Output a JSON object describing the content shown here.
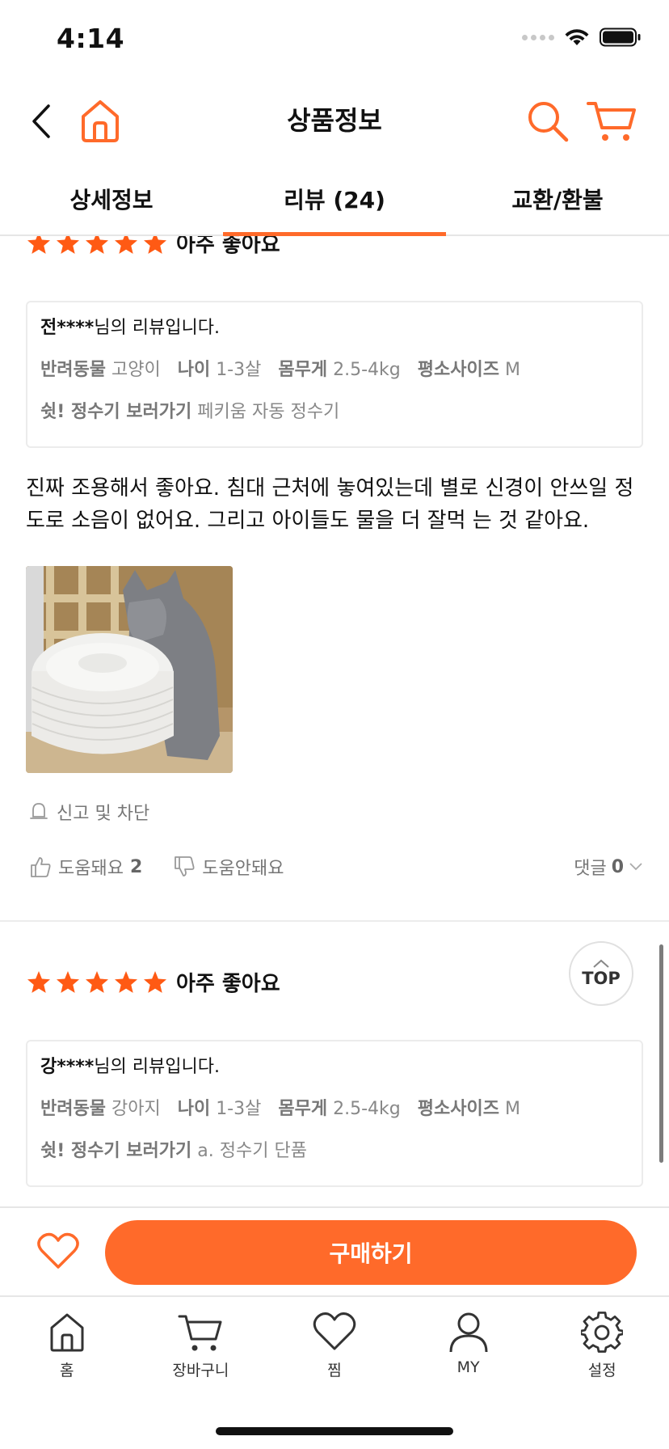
{
  "status_bar": {
    "time": "4:14"
  },
  "header": {
    "title": "상품정보"
  },
  "tabs": [
    {
      "label": "상세정보"
    },
    {
      "label": "리뷰 (24)"
    },
    {
      "label": "교환/환불"
    }
  ],
  "reviews": [
    {
      "rating": 5,
      "rating_text": "아주 좋아요",
      "user": "전****",
      "user_suffix": "님의 리뷰입니다.",
      "pet_label": "반려동물",
      "pet": "고양이",
      "age_label": "나이",
      "age": "1-3살",
      "weight_label": "몸무게",
      "weight": "2.5-4kg",
      "size_label": "평소사이즈",
      "size": "M",
      "option_label": "쉿! 정수기 보러가기",
      "option": "페키움 자동 정수기",
      "body": "진짜 조용해서 좋아요. 침대 근처에 놓여있는데 별로 신경이 안쓰일 정도로 소음이 없어요. 그리고 아이들도 물을 더 잘먹 는 것 같아요.",
      "report_label": "신고 및 차단",
      "helpful_label": "도움돼요",
      "helpful_count": "2",
      "unhelpful_label": "도움안돼요",
      "comment_label": "댓글",
      "comment_count": "0"
    },
    {
      "rating": 5,
      "rating_text": "아주 좋아요",
      "user": "강****",
      "user_suffix": "님의 리뷰입니다.",
      "pet_label": "반려동물",
      "pet": "강아지",
      "age_label": "나이",
      "age": "1-3살",
      "weight_label": "몸무게",
      "weight": "2.5-4kg",
      "size_label": "평소사이즈",
      "size": "M",
      "option_label": "쉿! 정수기 보러가기",
      "option": "a. 정수기 단품"
    }
  ],
  "top_button": {
    "label": "TOP"
  },
  "purchase": {
    "buy_label": "구매하기"
  },
  "bottom_nav": [
    {
      "label": "홈",
      "icon": "home-icon"
    },
    {
      "label": "장바구니",
      "icon": "cart-icon"
    },
    {
      "label": "찜",
      "icon": "heart-icon"
    },
    {
      "label": "MY",
      "icon": "user-icon"
    },
    {
      "label": "설정",
      "icon": "gear-icon"
    }
  ],
  "colors": {
    "accent": "#ff6a2a",
    "star": "#ff5a14"
  }
}
